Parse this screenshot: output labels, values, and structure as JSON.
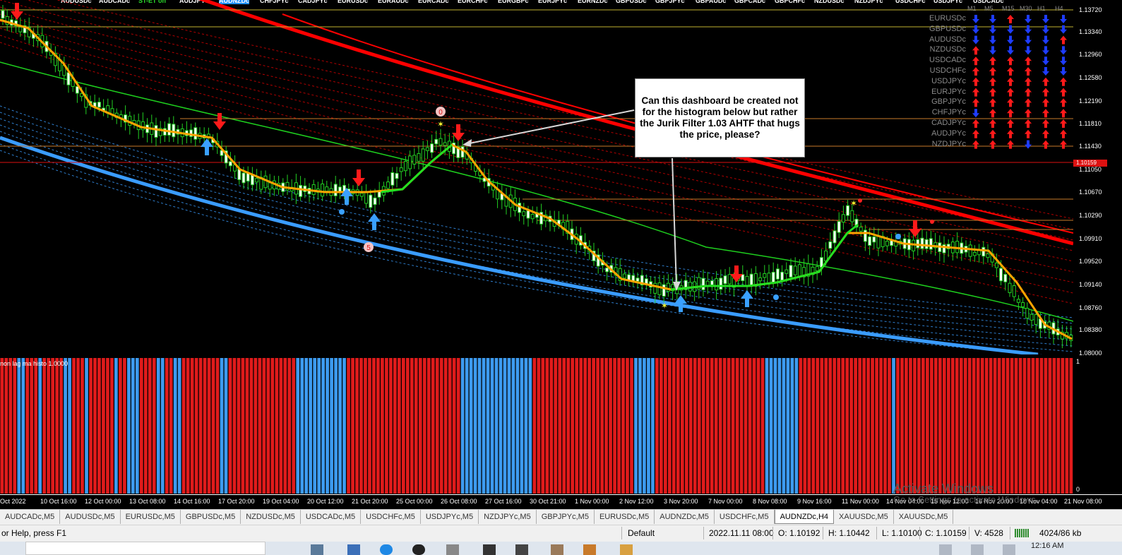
{
  "symbol_bar": {
    "items": [
      {
        "label": "AUDUSDc",
        "state": "normal"
      },
      {
        "label": "AUDCADc",
        "state": "normal"
      },
      {
        "label": "ST-ET on",
        "state": "green"
      },
      {
        "label": "AUDJPYc",
        "state": "normal"
      },
      {
        "label": "AUDNZDc",
        "state": "active"
      },
      {
        "label": "CHFJPYc",
        "state": "normal"
      },
      {
        "label": "CADJPYc",
        "state": "normal"
      },
      {
        "label": "EURUSDc",
        "state": "normal"
      },
      {
        "label": "EURAUDc",
        "state": "normal"
      },
      {
        "label": "EURCADc",
        "state": "normal"
      },
      {
        "label": "EURCHFc",
        "state": "normal"
      },
      {
        "label": "EURGBPc",
        "state": "normal"
      },
      {
        "label": "EURJPYc",
        "state": "normal"
      },
      {
        "label": "EURNZDc",
        "state": "normal"
      },
      {
        "label": "GBPUSDc",
        "state": "normal"
      },
      {
        "label": "GBPJPYc",
        "state": "normal"
      },
      {
        "label": "GBPAUDc",
        "state": "normal"
      },
      {
        "label": "GBPCADc",
        "state": "normal"
      },
      {
        "label": "GBPCHFc",
        "state": "normal"
      },
      {
        "label": "NZDUSDc",
        "state": "normal"
      },
      {
        "label": "NZDJPYc",
        "state": "normal"
      },
      {
        "label": "USDCHFc",
        "state": "normal"
      },
      {
        "label": "USDJPYc",
        "state": "normal"
      },
      {
        "label": "USDCADc",
        "state": "normal"
      }
    ]
  },
  "dashboard": {
    "timeframes": [
      "M1",
      "M5",
      "M15",
      "M30",
      "H1",
      "H4"
    ],
    "rows": [
      {
        "pair": "EURUSDc",
        "dirs": [
          "down",
          "down",
          "up",
          "down",
          "down",
          "down"
        ]
      },
      {
        "pair": "GBPUSDc",
        "dirs": [
          "down",
          "down",
          "down",
          "down",
          "down",
          "down"
        ]
      },
      {
        "pair": "AUDUSDc",
        "dirs": [
          "down",
          "down",
          "down",
          "down",
          "down",
          "up"
        ]
      },
      {
        "pair": "NZDUSDc",
        "dirs": [
          "up",
          "down",
          "down",
          "down",
          "down",
          "down"
        ]
      },
      {
        "pair": "USDCADc",
        "dirs": [
          "up",
          "up",
          "up",
          "up",
          "down",
          "down"
        ]
      },
      {
        "pair": "USDCHFc",
        "dirs": [
          "up",
          "up",
          "up",
          "up",
          "down",
          "down"
        ]
      },
      {
        "pair": "USDJPYc",
        "dirs": [
          "up",
          "up",
          "up",
          "up",
          "up",
          "up"
        ]
      },
      {
        "pair": "EURJPYc",
        "dirs": [
          "up",
          "up",
          "up",
          "up",
          "up",
          "up"
        ]
      },
      {
        "pair": "GBPJPYc",
        "dirs": [
          "up",
          "up",
          "up",
          "up",
          "up",
          "up"
        ]
      },
      {
        "pair": "CHFJPYc",
        "dirs": [
          "down",
          "up",
          "up",
          "up",
          "up",
          "up"
        ]
      },
      {
        "pair": "CADJPYc",
        "dirs": [
          "up",
          "up",
          "up",
          "up",
          "up",
          "up"
        ]
      },
      {
        "pair": "AUDJPYc",
        "dirs": [
          "up",
          "up",
          "up",
          "up",
          "up",
          "up"
        ]
      },
      {
        "pair": "NZDJPYc",
        "dirs": [
          "up",
          "up",
          "up",
          "down",
          "up",
          "up"
        ]
      }
    ]
  },
  "price_axis": {
    "labels": [
      "1.13720",
      "1.13340",
      "1.12960",
      "1.12580",
      "1.12190",
      "1.11810",
      "1.11430",
      "1.11050",
      "1.10670",
      "1.10290",
      "1.09910",
      "1.09520",
      "1.09140",
      "1.08760",
      "1.08380",
      "1.08000"
    ],
    "current_price": "1.10159"
  },
  "callout": {
    "text": "Can this dashboard be created not for the histogram below but rather the Jurik Filter 1.03 AHTF that hugs the price, please?"
  },
  "marker_labels": {
    "zero": "0",
    "five": "5"
  },
  "histogram": {
    "label": "non lag ma histo 1.0000",
    "axis_top": "1",
    "axis_bottom": "0",
    "sequence": "RRRRBBRRRBRRRRRBBRRRBRRRRRRBRRBBBRRRRBBRRBBRRRRRRRRRBBRRRRRRRRRRRRRRRRBBBBBBBBBBBBRRRRRRRRRRRRRRRRRRRRRRRRRRRBBBBBBBBBBBBBBBBBRRRRRRRRRRRRRRRRRRRRRRRRBBBBBRRRRRRRRRRRRRRRRRRRRRRRRRRBBBBBBBBRRRRRRRRRRRRRRRRRRRRRRBRRRRRRRRRRRRRRRRRRRRRRRRRRRRRRRRRRRRRRRRRR"
  },
  "time_axis": {
    "labels": [
      "Oct 2022",
      "10 Oct 16:00",
      "12 Oct 00:00",
      "13 Oct 08:00",
      "14 Oct 16:00",
      "17 Oct 20:00",
      "19 Oct 04:00",
      "20 Oct 12:00",
      "21 Oct 20:00",
      "25 Oct 00:00",
      "26 Oct 08:00",
      "27 Oct 16:00",
      "30 Oct 21:00",
      "1 Nov 00:00",
      "2 Nov 12:00",
      "3 Nov 20:00",
      "7 Nov 00:00",
      "8 Nov 08:00",
      "9 Nov 16:00",
      "11 Nov 00:00",
      "14 Nov 04:00",
      "15 Nov 12:00",
      "16 Nov 20:00",
      "18 Nov 04:00",
      "21 Nov 08:00"
    ]
  },
  "watermark": {
    "title": "Activate Windows",
    "subtitle": "Go to Settings to activate Windows."
  },
  "tabs": [
    {
      "label": "AUDCADc,M5",
      "active": false
    },
    {
      "label": "AUDUSDc,M5",
      "active": false
    },
    {
      "label": "EURUSDc,M5",
      "active": false
    },
    {
      "label": "GBPUSDc,M5",
      "active": false
    },
    {
      "label": "NZDUSDc,M5",
      "active": false
    },
    {
      "label": "USDCADc,M5",
      "active": false
    },
    {
      "label": "USDCHFc,M5",
      "active": false
    },
    {
      "label": "USDJPYc,M5",
      "active": false
    },
    {
      "label": "NZDJPYc,M5",
      "active": false
    },
    {
      "label": "GBPJPYc,M5",
      "active": false
    },
    {
      "label": "EURUSDc,M5",
      "active": false
    },
    {
      "label": "AUDNZDc,M5",
      "active": false
    },
    {
      "label": "USDCHFc,M5",
      "active": false
    },
    {
      "label": "AUDNZDc,H4",
      "active": true
    },
    {
      "label": "XAUUSDc,M5",
      "active": false
    },
    {
      "label": "XAUUSDc,M5",
      "active": false
    }
  ],
  "status_bar": {
    "help": "or Help, press F1",
    "profile": "Default",
    "datetime": "2022.11.11 08:00",
    "open": "O: 1.10192",
    "high": "H: 1.10442",
    "low": "L: 1.10100",
    "close": "C: 1.10159",
    "volume": "V: 4528",
    "traffic": "4024/86 kb"
  },
  "taskbar": {
    "clock": "12:16 AM"
  },
  "colors": {
    "up_arrow": "#ff1a1a",
    "down_arrow": "#1e3cff",
    "histo_red": "#e01b1b",
    "histo_blue": "#3d9bf0",
    "jurik_up": "#22e022",
    "jurik_down": "#ffa500",
    "ma_green": "#1ecf1e",
    "band_red": "#ff0000",
    "band_blue": "#3a9cff"
  }
}
